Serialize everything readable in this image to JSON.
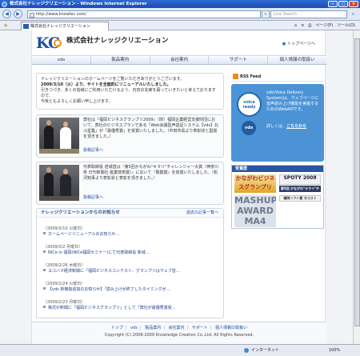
{
  "browser": {
    "window_title": "株式会社ナレッジクリエーション - Windows Internet Explorer",
    "url": "http://www.knowlec.com/",
    "search_placeholder": "Live Search",
    "tab_title": "株式会社ナレッジクリエーション",
    "commands": [
      "ページ(P)",
      "ツール(O)"
    ],
    "status_zone": "インターネット",
    "zoom": "100%"
  },
  "header": {
    "logo_text": "KC",
    "company_name": "株式会社ナレッジクリエーション",
    "top_link": "トップページへ"
  },
  "nav": {
    "items": [
      "vds",
      "製品案内",
      "会社案内",
      "サポート",
      "個人情報の取扱い"
    ]
  },
  "intro": {
    "line1": "ナレッジクリエーションのホームページをご覧いただきありがとうございます。",
    "line2": "2009/3/10（火）より、サイトを全面的にリニューアルいたしました。",
    "line3": "引きつづき、多くの皆様にご利用いただけるよう、内容の充実を図っていきたいと考えておりますので、",
    "line4": "今後ともよろしくお願い申し上げます。"
  },
  "news": [
    {
      "text": "弊社は『福岡ビジネスグランプリ2009』（財）福岡企業経営支援財団において、弊社のビジネスプランである「Web会議型声認証システム【vds】北斗星集」が「最優秀賞」を受賞いたしました。（中田市長より表彰状と副賞を頂きました。）",
      "more": "投稿記事へ"
    },
    {
      "text": "代表取締役 岩城直は『第5回かながわ\"キラリ\"チャレンジャー大賞（神奈川県 日刊新聞社 産業技術賞）』において『敢闘賞』を受賞いたしました。（松沢知事より表彰状と表彰を頂きました。）",
      "more": "投稿記事へ"
    }
  ],
  "notices": {
    "heading": "ナレッジクリエーションからのお知らせ",
    "all_link": "過去の記事一覧へ",
    "items": [
      {
        "date": "（2009/3/10 火曜日）",
        "title": "ホームページリニューアルのお知らせ…"
      },
      {
        "date": "（2009/3/2 月曜日）",
        "title": "NICe in 福岡(NICe福岡セミナー)にて代表取締役 新城…"
      },
      {
        "date": "（2009/2/26 木曜日）",
        "title": "ヨコハマ経済新聞に「福岡ビジネスコンテスト、グランプリはウェブ音…"
      },
      {
        "date": "（2009/2/24 火曜日）",
        "title": "【vds 新機能追加のお知らせ】「読み上げが終了したタイミングが…"
      },
      {
        "date": "（2009/2/23 月曜日）",
        "title": "株式が新聞に「福岡ビジネスグランプリ」として「弊社が最優秀賞受…"
      }
    ]
  },
  "sidebar": {
    "rss_label": "RSS Feed",
    "voice": {
      "bubble_text": "voice ready",
      "badge": "vds",
      "desc": "vds(Voice Delivery System)は、ウェブページに音声読み上げ機能を実装するためのWebAPIです。",
      "more_prefix": "詳しくは、",
      "more_link": "こちらから"
    },
    "awards_heading": "受賞歴",
    "awards": [
      "かながわビジネスグランプリ 2009",
      "SPOTY 2008",
      "第5回 かながわ\"キラリ\"チャレンジャー",
      "MASHUP AWARD MA4",
      "福岡ソフト賞 ヨコスト2007"
    ]
  },
  "footer": {
    "links": [
      "トップ",
      "vds",
      "製品案内",
      "会社案内",
      "サポート",
      "個人情報の取扱い"
    ],
    "copyright": "Copyright (C) 2008-2009 Knowledge Creation Co.,Ltd. All Rights Reserved."
  },
  "colors": {
    "brand_blue": "#1f4f9e",
    "accent_orange": "#f0961e",
    "voice_blue": "#4c93d6",
    "link_blue": "#1d4da6"
  }
}
